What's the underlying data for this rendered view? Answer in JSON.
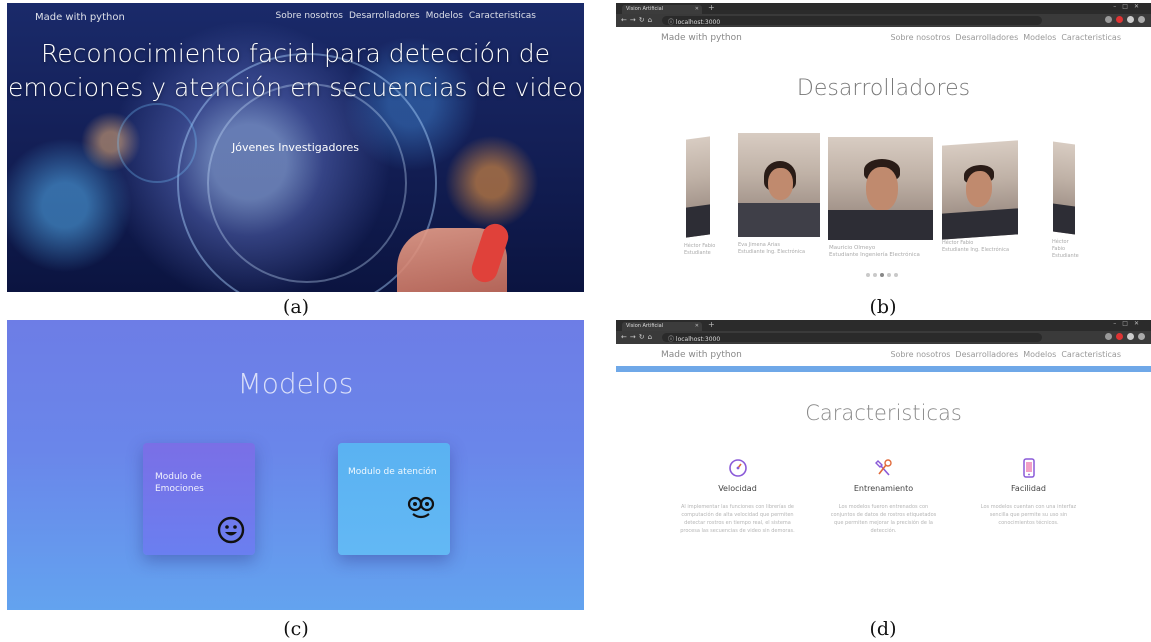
{
  "panel_a": {
    "brand": "Made with python",
    "nav": [
      "Sobre nosotros",
      "Desarrolladores",
      "Modelos",
      "Caracteristicas"
    ],
    "title_line1": "Reconocimiento facial para detección de",
    "title_line2": "emociones y atención en secuencias de video",
    "subtitle": "Jóvenes Investigadores",
    "caption": "(a)"
  },
  "panel_b": {
    "tab_title": "Vision Artificial",
    "url": "localhost:3000",
    "brand": "Made with python",
    "nav": [
      "Sobre nosotros",
      "Desarrolladores",
      "Modelos",
      "Caracteristicas"
    ],
    "heading": "Desarrolladores",
    "developers": [
      {
        "name": "Héctor Fabio",
        "role": "Estudiante"
      },
      {
        "name": "Eva Jimena Arias",
        "role": "Estudiante Ing. Electrónica"
      },
      {
        "name": "Mauricio Olmeyo",
        "role": "Estudiante Ingeniería Electrónica"
      },
      {
        "name": "Héctor Fabio",
        "role": "Estudiante Ing. Electrónica"
      },
      {
        "name": "Héctor Fabio",
        "role": "Estudiante"
      }
    ],
    "active_dot": 2,
    "dot_count": 5,
    "caption": "(b)"
  },
  "panel_c": {
    "heading": "Modelos",
    "card_emotions": "Modulo de Emociones",
    "card_attention": "Modulo de atención",
    "caption": "(c)"
  },
  "panel_d": {
    "tab_title": "Vision Artificial",
    "url": "localhost:3000",
    "brand": "Made with python",
    "nav": [
      "Sobre nosotros",
      "Desarrolladores",
      "Modelos",
      "Caracteristicas"
    ],
    "heading": "Caracteristicas",
    "features": [
      {
        "icon": "speedometer-icon",
        "title": "Velocidad",
        "text": "Al implementar las funciones con librerías de computación de alta velocidad que permiten detectar rostros en tiempo real, el sistema procesa las secuencias de video sin demoras."
      },
      {
        "icon": "tools-icon",
        "title": "Entrenamiento",
        "text": "Los modelos fueron entrenados con conjuntos de datos de rostros etiquetados que permiten mejorar la precisión de la detección."
      },
      {
        "icon": "mobile-icon",
        "title": "Facilidad",
        "text": "Los modelos cuentan con una interfaz sencilla que permite su uso sin conocimientos técnicos."
      }
    ],
    "caption": "(d)"
  },
  "colors": {
    "panel_c_top": "#6d7de6",
    "panel_c_bottom": "#63a3ef",
    "card_emotions": "#7a6fe6",
    "card_attention": "#5ab2f2",
    "panel_d_stripe": "#6fa8e8",
    "feature_icon_purple": "#8a5ad8"
  }
}
